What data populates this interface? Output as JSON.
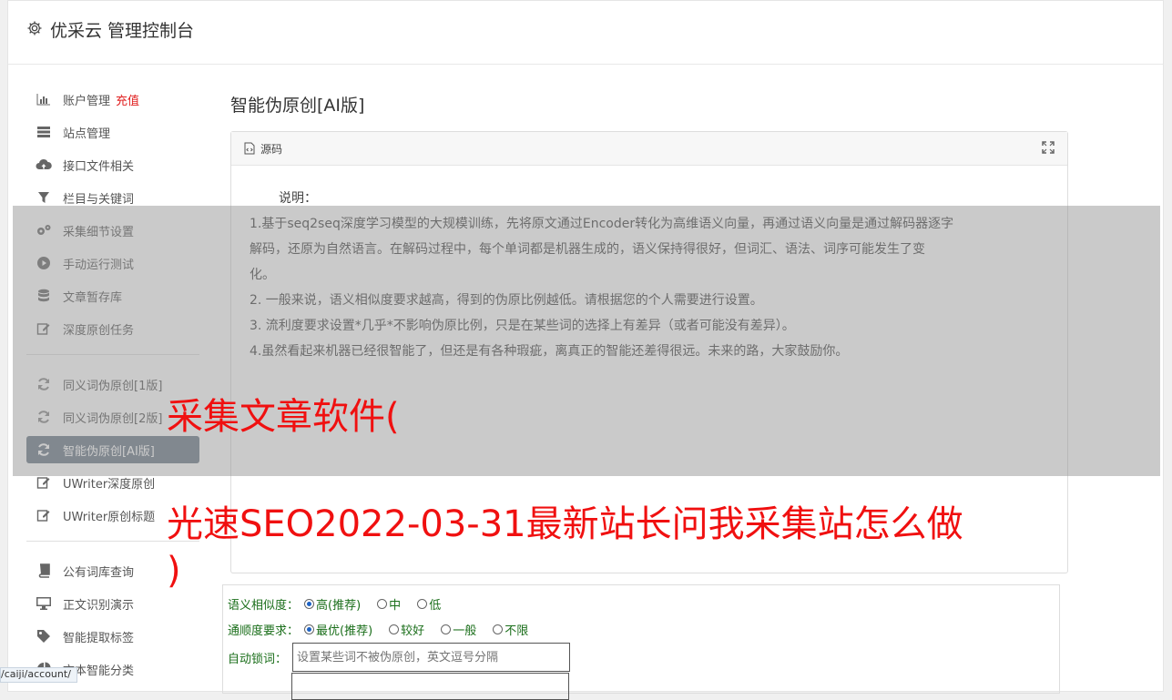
{
  "header": {
    "title": "优采云 管理控制台"
  },
  "sidebar": {
    "group1": [
      {
        "label": "账户管理",
        "badge": "充值",
        "icon": "bar-chart-icon"
      },
      {
        "label": "站点管理",
        "icon": "server-icon"
      },
      {
        "label": "接口文件相关",
        "icon": "cloud-upload-icon"
      },
      {
        "label": "栏目与关键词",
        "icon": "filter-icon"
      },
      {
        "label": "采集细节设置",
        "icon": "gears-icon"
      },
      {
        "label": "手动运行测试",
        "icon": "play-circle-icon"
      },
      {
        "label": "文章暂存库",
        "icon": "database-icon"
      },
      {
        "label": "深度原创任务",
        "icon": "edit-icon"
      }
    ],
    "group2": [
      {
        "label": "同义词伪原创[1版]",
        "icon": "refresh-icon"
      },
      {
        "label": "同义词伪原创[2版]",
        "icon": "refresh-icon"
      },
      {
        "label": "智能伪原创[AI版]",
        "icon": "refresh-icon",
        "active": true
      },
      {
        "label": "UWriter深度原创",
        "icon": "edit-icon"
      },
      {
        "label": "UWriter原创标题",
        "icon": "edit-icon"
      }
    ],
    "group3": [
      {
        "label": "公有词库查询",
        "icon": "book-icon"
      },
      {
        "label": "正文识别演示",
        "icon": "monitor-icon"
      },
      {
        "label": "智能提取标签",
        "icon": "tag-icon"
      },
      {
        "label": "文本智能分类",
        "icon": "pie-chart-icon"
      }
    ]
  },
  "main": {
    "title": "智能伪原创[AI版]",
    "panel": {
      "head_label": "源码",
      "intro_title": "说明：",
      "lines": [
        "1.基于seq2seq深度学习模型的大规模训练，先将原文通过Encoder转化为高维语义向量，再通过语义向量是通过解码器逐字",
        "解码，还原为自然语言。在解码过程中，每个单词都是机器生成的，语义保持得很好，但词汇、语法、词序可能发生了变",
        "化。",
        "2. 一般来说，语义相似度要求越高，得到的伪原比例越低。请根据您的个人需要进行设置。",
        "3. 流利度要求设置*几乎*不影响伪原比例，只是在某些词的选择上有差异（或者可能没有差异）。",
        "4.虽然看起来机器已经很智能了，但还是有各种瑕疵，离真正的智能还差得很远。未来的路，大家鼓励你。"
      ]
    },
    "form": {
      "similarity_label": "语义相似度：",
      "similarity_options": [
        "高(推荐)",
        "中",
        "低"
      ],
      "fluency_label": "通顺度要求：",
      "fluency_options": [
        "最优(推荐)",
        "较好",
        "一般",
        "不限"
      ],
      "lock_label": "自动锁词：",
      "lock_placeholder": "设置某些词不被伪原创，英文逗号分隔"
    }
  },
  "overlay": {
    "line1": "采集文章软件(",
    "line2": "光速SEO2022-03-31最新站长问我采集站怎么做",
    "line3": ")"
  },
  "status_url": "/caiji/account/",
  "colors": {
    "accent_red": "#f01010",
    "active_nav": "#6c7a89",
    "form_green": "#1a6e1a"
  }
}
